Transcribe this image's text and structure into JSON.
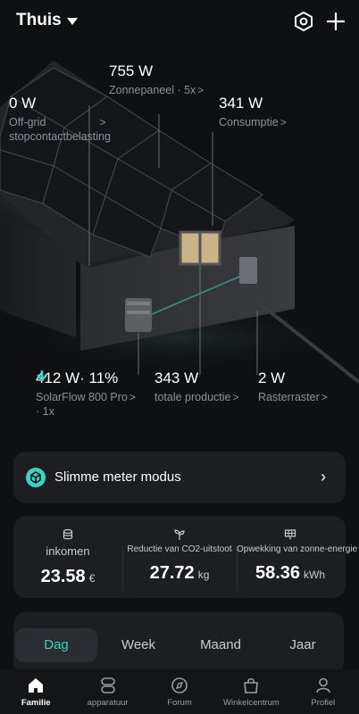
{
  "header": {
    "title": "Thuis",
    "icons": [
      "hexagon-settings-icon",
      "plus-icon"
    ]
  },
  "scene": {
    "solar": {
      "value": "755 W",
      "label": "Zonnepaneel · 5x"
    },
    "offgrid": {
      "value": "0 W",
      "label_line1": "Off-grid",
      "label_line2": "stopcontactbelasting"
    },
    "consumption": {
      "value": "341 W",
      "label": "Consumptie"
    },
    "solarflow": {
      "value": "412 W· 11%",
      "label_line1": "SolarFlow 800 Pro",
      "label_line2": "· 1x"
    },
    "production": {
      "value": "343 W",
      "label": "totale productie"
    },
    "grid": {
      "value": "2 W",
      "label": "Rasterraster"
    },
    "accent": "#3fd1bf"
  },
  "meter_card": {
    "label": "Slimme meter modus"
  },
  "stats": {
    "income": {
      "label": "inkomen",
      "value": "23.58",
      "unit": "€"
    },
    "co2": {
      "label": "Reductie van CO2-uitstoot",
      "value": "27.72",
      "unit": "kg"
    },
    "generation": {
      "label": "Opwekking van zonne-energie",
      "value": "58.36",
      "unit": "kWh"
    }
  },
  "period_tabs": [
    "Dag",
    "Week",
    "Maand",
    "Jaar"
  ],
  "nav": [
    "Familie",
    "apparatuur",
    "Forum",
    "Winkelcentrum",
    "Profiel"
  ]
}
